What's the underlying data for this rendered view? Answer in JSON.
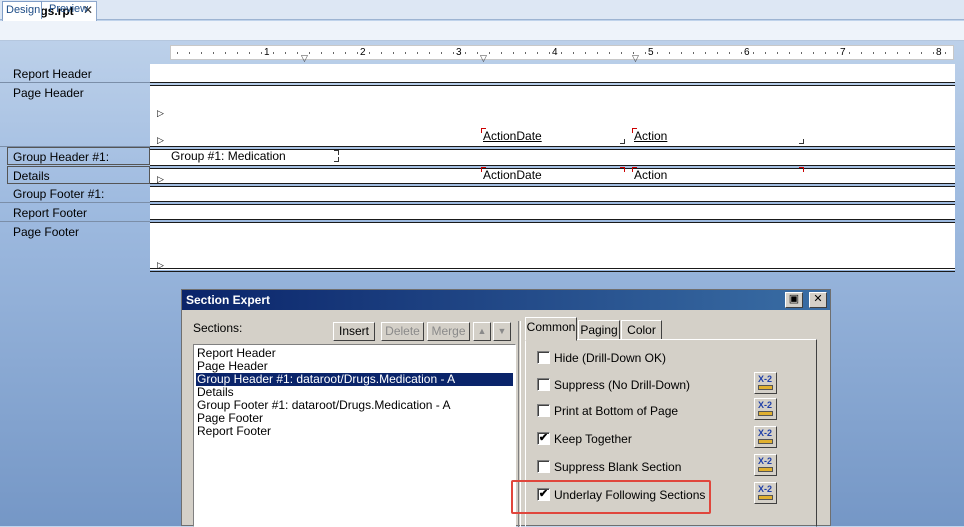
{
  "document_tab": {
    "title": "drugs.rpt",
    "close": "✕"
  },
  "view_tabs": {
    "design": "Design",
    "preview": "Preview"
  },
  "ruler": {
    "numbers": [
      "1",
      "2",
      "3",
      "4",
      "5",
      "6",
      "7",
      "8"
    ]
  },
  "section_labels": {
    "report_header": "Report Header",
    "page_header": "Page Header",
    "group_header": "Group Header #1:",
    "details": "Details",
    "group_footer": "Group Footer #1:",
    "report_footer": "Report Footer",
    "page_footer": "Page Footer"
  },
  "fields": {
    "page_header_action_date": "ActionDate",
    "page_header_action": "Action",
    "group_header_field": "Group #1: Medication",
    "details_action_date": "ActionDate",
    "details_action": "Action"
  },
  "dialog": {
    "title": "Section Expert",
    "sections_label": "Sections:",
    "buttons": {
      "insert": "Insert",
      "delete": "Delete",
      "merge": "Merge",
      "up": "▲",
      "down": "▼"
    },
    "sections": [
      "Report Header",
      "Page Header",
      "Group Header #1: dataroot/Drugs.Medication - A",
      "Details",
      "Group Footer #1: dataroot/Drugs.Medication - A",
      "Page Footer",
      "Report Footer"
    ],
    "selected_index": 2,
    "tabs": {
      "common": "Common",
      "paging": "Paging",
      "color": "Color"
    },
    "options": [
      {
        "label": "Hide (Drill-Down OK)",
        "checked": false,
        "formula": false
      },
      {
        "label": "Suppress (No Drill-Down)",
        "checked": false,
        "formula": true
      },
      {
        "label": "Print at Bottom of Page",
        "checked": false,
        "formula": true
      },
      {
        "label": "Keep Together",
        "checked": true,
        "formula": true
      },
      {
        "label": "Suppress Blank Section",
        "checked": false,
        "formula": true
      },
      {
        "label": "Underlay Following Sections",
        "checked": true,
        "formula": true
      }
    ],
    "formula_button_text": "X-2",
    "check_mark": "✔",
    "highlight_color": "#e0463c"
  }
}
